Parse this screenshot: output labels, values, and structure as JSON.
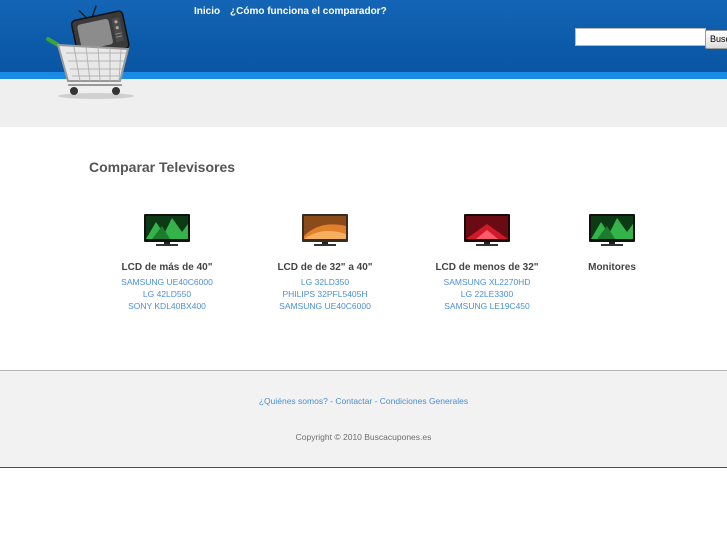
{
  "nav": {
    "inicio": "Inicio",
    "como_funciona": "¿Cómo funciona el comparador?"
  },
  "search": {
    "button_label": "Buscar",
    "value": ""
  },
  "page_title": "Comparar Televisores",
  "categories": [
    {
      "title": "LCD de más de 40\"",
      "screen": "green",
      "links": [
        "SAMSUNG UE40C6000",
        "LG 42LD550",
        "SONY KDL40BX400"
      ]
    },
    {
      "title": "LCD de de 32\" a 40\"",
      "screen": "orange",
      "links": [
        "LG 32LD350",
        "PHILIPS 32PFL5405H",
        "SAMSUNG UE40C6000"
      ]
    },
    {
      "title": "LCD de menos de 32\"",
      "screen": "red",
      "links": [
        "SAMSUNG XL2270HD",
        "LG 22LE3300",
        "SAMSUNG LE19C450"
      ]
    },
    {
      "title": "Monitores",
      "screen": "green",
      "links": []
    }
  ],
  "footer": {
    "quienes": "¿Quiénes somos?",
    "separator": " - ",
    "contactar": "Contactar",
    "condiciones": "Condiciones Generales",
    "copyright": "Copyright © 2010 Buscacupones.es"
  },
  "colors": {
    "header_blue": "#0b5aa9",
    "header_stripe": "#1a8ce6",
    "link_blue": "#4b8fd6"
  }
}
